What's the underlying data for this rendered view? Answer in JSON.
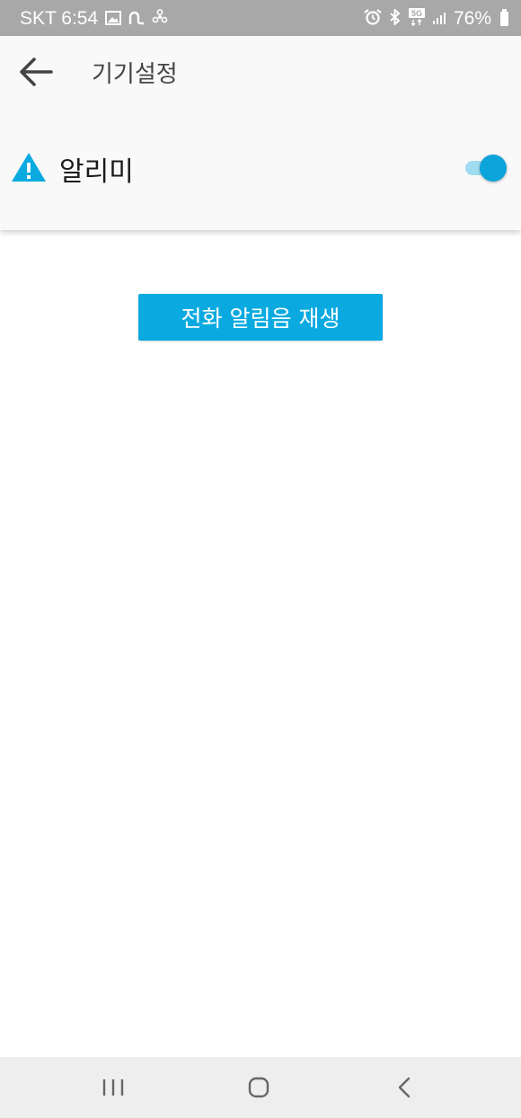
{
  "status_bar": {
    "carrier_time": "SKT 6:54",
    "battery_percent": "76%",
    "network": "5G",
    "left_icons": [
      "image-icon",
      "signal-wave-icon",
      "fan-icon"
    ],
    "right_icons": [
      "alarm-clock-icon",
      "bluetooth-icon",
      "5g-icon",
      "signal-bars-icon",
      "battery-icon"
    ]
  },
  "header": {
    "title": "기기설정",
    "back_icon": "back-arrow-icon"
  },
  "alarm": {
    "label": "알리미",
    "icon": "warning-icon",
    "enabled": true
  },
  "actions": {
    "play_ring_label": "전화 알림음 재생"
  },
  "nav": {
    "recents_icon": "recent-apps-icon",
    "home_icon": "home-icon",
    "back_icon": "back-icon"
  },
  "colors": {
    "accent": "#0aaae0",
    "toggle_track": "#9fdcf0",
    "status_bar": "#a8a8a8",
    "nav_bar": "#eeeeee"
  }
}
